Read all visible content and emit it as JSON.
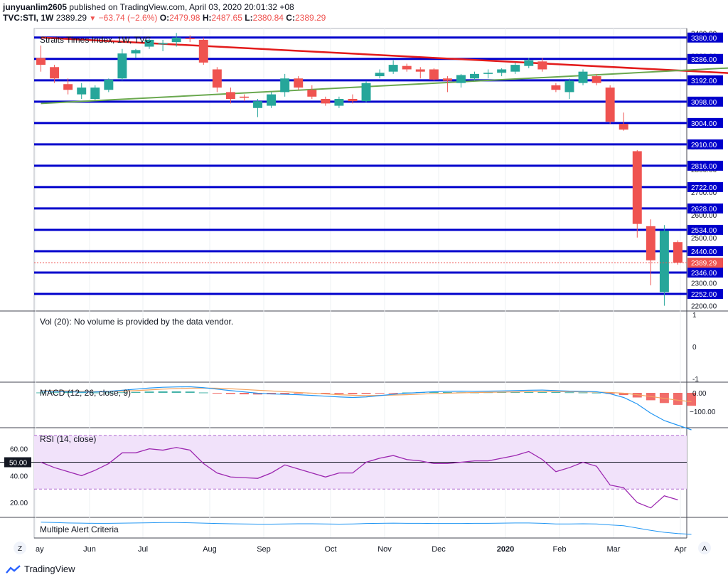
{
  "header": {
    "user": "junyuanlim2605",
    "published": "published on TradingView.com, April 03, 2020 20:01:32 +08",
    "symbol": "TVC:STI, 1W",
    "last": "2389.29",
    "change": "−63.74 (−2.6%)",
    "o_label": "O:",
    "o_val": "2479.98",
    "h_label": "H:",
    "h_val": "2487.65",
    "l_label": "L:",
    "l_val": "2380.84",
    "c_label": "C:",
    "c_val": "2389.29"
  },
  "colors": {
    "up": "#26a69a",
    "down": "#ef5350",
    "level": "#0000cc",
    "trend_down": "#e31b1b",
    "trend_up": "#6aa84f",
    "macd": "#2196f3",
    "signal": "#f4a460",
    "rsi": "#9c27b0",
    "rsi_band": "#f1e2fa"
  },
  "footer": {
    "logo_text": "TradingView",
    "z_button": "Z",
    "a_button": "A"
  },
  "chart_data": {
    "type": "candlestick",
    "title": "Straits Times Index, 1W, TVC",
    "x_labels": [
      "ay",
      "Jun",
      "Jul",
      "Aug",
      "Sep",
      "Oct",
      "Nov",
      "Dec",
      "2020",
      "Feb",
      "Mar",
      "Apr"
    ],
    "price_ylim": [
      2180,
      3420
    ],
    "price_ticks": [
      2200,
      2300,
      2400,
      2500,
      2600,
      2700,
      2800,
      2900,
      3000,
      3100,
      3200,
      3300,
      3400
    ],
    "level_labels": [
      "3380.00",
      "3286.00",
      "3192.00",
      "3098.00",
      "3004.00",
      "2910.00",
      "2816.00",
      "2722.00",
      "2628.00",
      "2534.00",
      "2440.00",
      "2346.00",
      "2252.00"
    ],
    "last_price_label": "2389.29",
    "trendlines": [
      {
        "start_week": 0,
        "start": 3380,
        "end_week": 52,
        "end": 3220
      },
      {
        "start_week": 0,
        "start": 3090,
        "end_week": 52,
        "end": 3250
      }
    ],
    "candles": [
      {
        "o": 3290,
        "h": 3345,
        "l": 3230,
        "c": 3260
      },
      {
        "o": 3250,
        "h": 3260,
        "l": 3180,
        "c": 3200
      },
      {
        "o": 3175,
        "h": 3200,
        "l": 3130,
        "c": 3150
      },
      {
        "o": 3130,
        "h": 3180,
        "l": 3110,
        "c": 3160
      },
      {
        "o": 3110,
        "h": 3170,
        "l": 3105,
        "c": 3160
      },
      {
        "o": 3150,
        "h": 3200,
        "l": 3140,
        "c": 3195
      },
      {
        "o": 3200,
        "h": 3330,
        "l": 3190,
        "c": 3310
      },
      {
        "o": 3310,
        "h": 3330,
        "l": 3290,
        "c": 3325
      },
      {
        "o": 3340,
        "h": 3375,
        "l": 3330,
        "c": 3370
      },
      {
        "o": 3350,
        "h": 3370,
        "l": 3320,
        "c": 3355
      },
      {
        "o": 3360,
        "h": 3400,
        "l": 3340,
        "c": 3380
      },
      {
        "o": 3378,
        "h": 3390,
        "l": 3360,
        "c": 3375
      },
      {
        "o": 3370,
        "h": 3380,
        "l": 3260,
        "c": 3270
      },
      {
        "o": 3240,
        "h": 3250,
        "l": 3140,
        "c": 3160
      },
      {
        "o": 3140,
        "h": 3160,
        "l": 3090,
        "c": 3110
      },
      {
        "o": 3120,
        "h": 3130,
        "l": 3100,
        "c": 3115
      },
      {
        "o": 3070,
        "h": 3110,
        "l": 3030,
        "c": 3100
      },
      {
        "o": 3080,
        "h": 3140,
        "l": 3070,
        "c": 3130
      },
      {
        "o": 3140,
        "h": 3220,
        "l": 3120,
        "c": 3200
      },
      {
        "o": 3200,
        "h": 3210,
        "l": 3150,
        "c": 3160
      },
      {
        "o": 3150,
        "h": 3170,
        "l": 3110,
        "c": 3120
      },
      {
        "o": 3110,
        "h": 3120,
        "l": 3080,
        "c": 3090
      },
      {
        "o": 3080,
        "h": 3120,
        "l": 3070,
        "c": 3110
      },
      {
        "o": 3110,
        "h": 3130,
        "l": 3090,
        "c": 3100
      },
      {
        "o": 3100,
        "h": 3190,
        "l": 3095,
        "c": 3180
      },
      {
        "o": 3210,
        "h": 3240,
        "l": 3200,
        "c": 3225
      },
      {
        "o": 3230,
        "h": 3280,
        "l": 3220,
        "c": 3260
      },
      {
        "o": 3255,
        "h": 3265,
        "l": 3230,
        "c": 3240
      },
      {
        "o": 3240,
        "h": 3250,
        "l": 3200,
        "c": 3230
      },
      {
        "o": 3240,
        "h": 3245,
        "l": 3190,
        "c": 3195
      },
      {
        "o": 3200,
        "h": 3210,
        "l": 3140,
        "c": 3190
      },
      {
        "o": 3180,
        "h": 3220,
        "l": 3160,
        "c": 3215
      },
      {
        "o": 3200,
        "h": 3230,
        "l": 3190,
        "c": 3220
      },
      {
        "o": 3220,
        "h": 3240,
        "l": 3200,
        "c": 3225
      },
      {
        "o": 3225,
        "h": 3245,
        "l": 3210,
        "c": 3240
      },
      {
        "o": 3230,
        "h": 3270,
        "l": 3220,
        "c": 3260
      },
      {
        "o": 3255,
        "h": 3290,
        "l": 3245,
        "c": 3280
      },
      {
        "o": 3275,
        "h": 3290,
        "l": 3230,
        "c": 3240
      },
      {
        "o": 3170,
        "h": 3180,
        "l": 3140,
        "c": 3150
      },
      {
        "o": 3140,
        "h": 3200,
        "l": 3110,
        "c": 3190
      },
      {
        "o": 3180,
        "h": 3240,
        "l": 3170,
        "c": 3230
      },
      {
        "o": 3210,
        "h": 3220,
        "l": 3170,
        "c": 3180
      },
      {
        "o": 3160,
        "h": 3170,
        "l": 3000,
        "c": 3010
      },
      {
        "o": 3000,
        "h": 3050,
        "l": 2970,
        "c": 2975
      },
      {
        "o": 2880,
        "h": 2885,
        "l": 2500,
        "c": 2560
      },
      {
        "o": 2550,
        "h": 2580,
        "l": 2290,
        "c": 2400
      },
      {
        "o": 2260,
        "h": 2555,
        "l": 2200,
        "c": 2530
      },
      {
        "o": 2479.98,
        "h": 2487.65,
        "l": 2380.84,
        "c": 2389.29
      }
    ],
    "volume": {
      "label": "Vol (20): No volume is provided by the data vendor.",
      "ticks": [
        "1",
        "0",
        "-1"
      ]
    },
    "macd": {
      "label": "MACD (12, 26, close, 9)",
      "ticks": [
        "0.00",
        "−100.00"
      ],
      "hist": [
        2,
        3,
        4,
        3,
        2,
        2,
        3,
        5,
        7,
        8,
        8,
        7,
        2,
        -3,
        -6,
        -8,
        -9,
        -8,
        -6,
        -4,
        -3,
        -4,
        -6,
        -7,
        -6,
        -4,
        -2,
        2,
        4,
        5,
        4,
        3,
        2,
        3,
        4,
        5,
        6,
        5,
        4,
        3,
        2,
        1,
        -5,
        -12,
        -25,
        -40,
        -55,
        -65,
        -70
      ],
      "macd": [
        10,
        8,
        6,
        4,
        5,
        8,
        14,
        20,
        26,
        30,
        32,
        33,
        28,
        20,
        12,
        5,
        -2,
        -6,
        -8,
        -10,
        -14,
        -18,
        -22,
        -25,
        -22,
        -15,
        -8,
        -2,
        2,
        6,
        8,
        9,
        8,
        9,
        10,
        12,
        14,
        15,
        12,
        9,
        8,
        6,
        -5,
        -25,
        -60,
        -110,
        -150,
        -175,
        -200
      ],
      "signal": [
        12,
        11,
        10,
        8,
        7,
        7,
        9,
        12,
        16,
        20,
        23,
        25,
        26,
        25,
        22,
        18,
        14,
        10,
        6,
        2,
        -2,
        -6,
        -10,
        -13,
        -15,
        -14,
        -12,
        -10,
        -7,
        -4,
        -2,
        0,
        2,
        3,
        4,
        5,
        6,
        7,
        7,
        6,
        5,
        4,
        2,
        -2,
        -10,
        -20,
        -30,
        -40,
        -48
      ]
    },
    "rsi": {
      "label": "RSI (14, close)",
      "ticks": [
        "60.00",
        "50.00",
        "40.00",
        "20.00"
      ],
      "band": [
        30,
        70
      ],
      "midline": 50,
      "ylim": [
        10,
        72
      ],
      "values": [
        50,
        46,
        43,
        40,
        44,
        49,
        57,
        57,
        60,
        59,
        61,
        59,
        49,
        42,
        39,
        38.5,
        38,
        42,
        48,
        45,
        42,
        39,
        42,
        42,
        50,
        53,
        55,
        52,
        51,
        49,
        49,
        50,
        51,
        51,
        53,
        55,
        58,
        52,
        43,
        46,
        50,
        47,
        33,
        31,
        20,
        16,
        25,
        22
      ]
    },
    "alert": {
      "label": "Multiple Alert Criteria",
      "values": [
        90,
        88,
        86,
        85,
        84,
        84,
        85,
        86,
        87,
        88,
        88,
        87,
        85,
        83,
        82,
        81,
        80,
        80,
        81,
        82,
        82,
        81,
        80,
        81,
        83,
        84,
        85,
        84,
        84,
        83,
        83,
        83,
        84,
        84,
        85,
        86,
        86,
        84,
        81,
        81,
        82,
        81,
        76,
        72,
        60,
        48,
        38,
        32,
        28
      ]
    }
  }
}
